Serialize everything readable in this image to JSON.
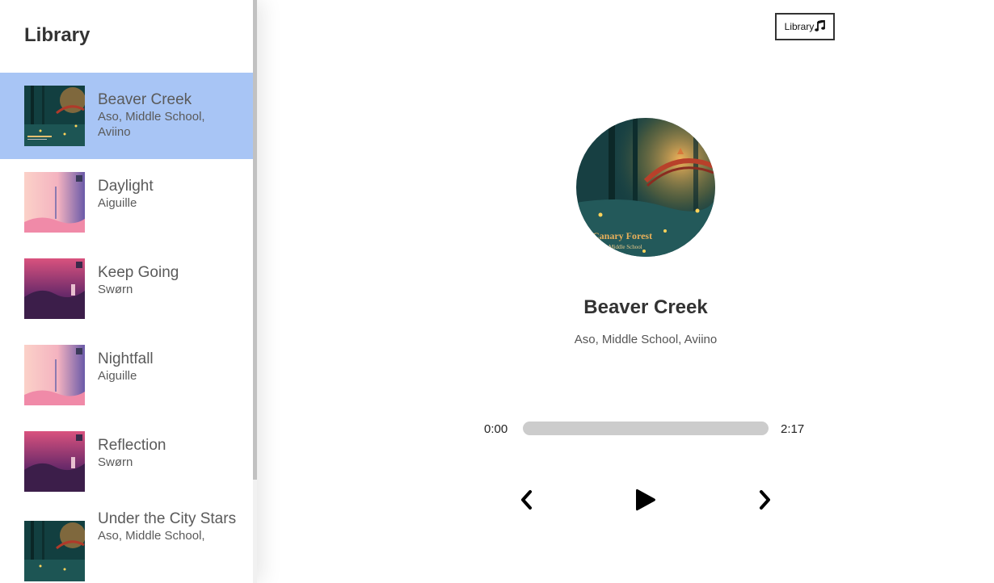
{
  "sidebar": {
    "title": "Library",
    "songs": [
      {
        "title": "Beaver Creek",
        "artist_line1": "Aso, Middle School,",
        "artist_line2": "Aviino",
        "selected": true,
        "cover": "canary-forest"
      },
      {
        "title": "Daylight",
        "artist_line1": "Aiguille",
        "artist_line2": "",
        "selected": false,
        "cover": "pink-sky"
      },
      {
        "title": "Keep Going",
        "artist_line1": "Swørn",
        "artist_line2": "",
        "selected": false,
        "cover": "purple-landscape"
      },
      {
        "title": "Nightfall",
        "artist_line1": "Aiguille",
        "artist_line2": "",
        "selected": false,
        "cover": "pink-sky"
      },
      {
        "title": "Reflection",
        "artist_line1": "Swørn",
        "artist_line2": "",
        "selected": false,
        "cover": "purple-landscape"
      },
      {
        "title": "Under the City Stars",
        "artist_line1": "Aso, Middle School,",
        "artist_line2": "",
        "selected": false,
        "cover": "canary-forest"
      }
    ]
  },
  "header": {
    "library_button_label": "Library",
    "library_button_icon": "music-note-icon"
  },
  "player": {
    "title": "Beaver Creek",
    "artist": "Aso, Middle School, Aviino",
    "album_art": "canary-forest",
    "album_art_text_line1": "Canary Forest",
    "album_art_text_line2": "Aso x Middle School",
    "current_time": "0:00",
    "total_time": "2:17",
    "progress_fraction": 0
  },
  "controls": {
    "prev_icon": "chevron-left-icon",
    "play_icon": "play-icon",
    "next_icon": "chevron-right-icon"
  },
  "colors": {
    "selected_row": "#a8c5f5",
    "text_dark": "#333333",
    "progress_track": "#cccccc"
  }
}
